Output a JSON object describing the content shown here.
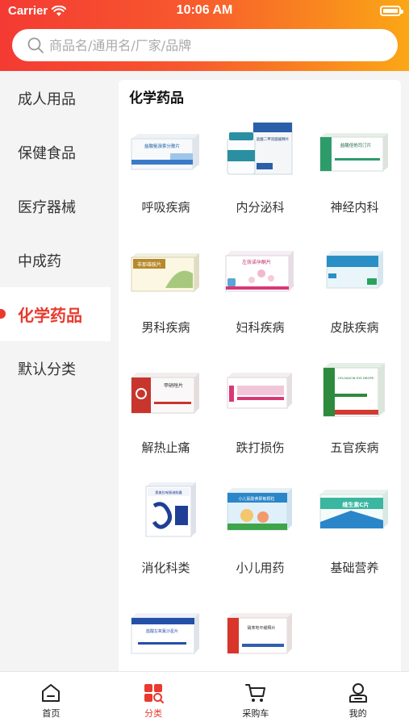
{
  "status_bar": {
    "carrier": "Carrier",
    "time": "10:06 AM"
  },
  "search": {
    "placeholder": "商品名/通用名/厂家/品牌"
  },
  "sidebar": {
    "items": [
      {
        "label": "成人用品",
        "active": false
      },
      {
        "label": "保健食品",
        "active": false
      },
      {
        "label": "医疗器械",
        "active": false
      },
      {
        "label": "中成药",
        "active": false
      },
      {
        "label": "化学药品",
        "active": true
      },
      {
        "label": "默认分类",
        "active": false
      }
    ]
  },
  "content": {
    "title": "化学药品",
    "categories": [
      {
        "label": "呼吸疾病",
        "box_text": "盐酸氨溴索分散片"
      },
      {
        "label": "内分泌科",
        "box_text": "盐酸二甲双胍缓释片"
      },
      {
        "label": "神经内科",
        "box_text": "盐酸倍他司汀片"
      },
      {
        "label": "男科疾病",
        "box_text": "非那雄胺片"
      },
      {
        "label": "妇科疾病",
        "box_text": "左炔诺孕酮片"
      },
      {
        "label": "皮肤疾病",
        "box_text": ""
      },
      {
        "label": "解热止痛",
        "box_text": "甲硝唑片"
      },
      {
        "label": "跌打损伤",
        "box_text": ""
      },
      {
        "label": "五官疾病",
        "box_text": "OFLOXACIN EYE DROPS"
      },
      {
        "label": "消化科类",
        "box_text": "奥美拉唑肠溶胶囊"
      },
      {
        "label": "小儿用药",
        "box_text": "小儿氨酚黄那敏颗粒"
      },
      {
        "label": "基础营养",
        "box_text": "维生素C片"
      },
      {
        "label": "",
        "box_text": "盐酸左氧氟沙星片"
      },
      {
        "label": "",
        "box_text": "硝苯地平缓释片"
      }
    ]
  },
  "tabbar": {
    "tabs": [
      {
        "label": "首页",
        "icon": "home-icon",
        "active": false
      },
      {
        "label": "分类",
        "icon": "category-icon",
        "active": true
      },
      {
        "label": "采购车",
        "icon": "cart-icon",
        "active": false
      },
      {
        "label": "我的",
        "icon": "profile-icon",
        "active": false
      }
    ]
  },
  "colors": {
    "accent": "#e83a2f",
    "header_start": "#f43a33",
    "header_end": "#fba716"
  }
}
